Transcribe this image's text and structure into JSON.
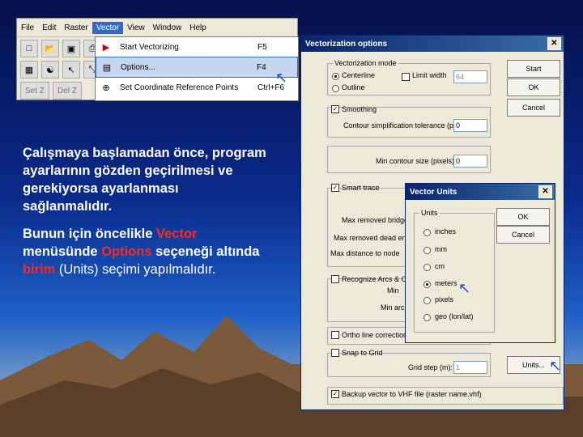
{
  "app": {
    "menu": [
      "File",
      "Edit",
      "Raster",
      "Vector",
      "View",
      "Window",
      "Help"
    ],
    "active_menu": "Vector",
    "toolbar_buttons": [
      "Set Z",
      "Del Z"
    ],
    "dropdown": [
      {
        "label": "Start Vectorizing",
        "key": "F5",
        "icon": "play-icon"
      },
      {
        "label": "Options...",
        "key": "F4",
        "icon": "options-icon"
      },
      {
        "label": "Set Coordinate Reference Points",
        "key": "Ctrl+F6",
        "icon": "crosshair-icon"
      }
    ]
  },
  "text": {
    "p1": "Çalışmaya başlamadan önce, program ayarlarının gözden geçirilmesi ve gerekiyorsa ayarlanması sağlanmalıdır.",
    "p2_a": "Bunun için öncelikle ",
    "p2_vector": "Vector",
    "p2_b": " menüsünde ",
    "p2_options": "Options",
    "p2_c": " seçeneği altında ",
    "p2_birim": "birim",
    "p2_d": " (Units) seçimi yapılmalıdır."
  },
  "dialog": {
    "title": "Vectorization options",
    "mode_group": "Vectorization mode",
    "centerline": "Centerline",
    "outline": "Outline",
    "limit_width": "Limit width",
    "limit_width_value": "64",
    "smoothing": "Smoothing",
    "tolerance_label": "Contour simplification tolerance (pixels):",
    "tolerance_value": "0",
    "min_contour_label": "Min contour size (pixels):",
    "min_contour_value": "0",
    "smart_trace": "Smart trace",
    "max_bridge": "Max removed bridge",
    "max_dead_end": "Max removed dead end",
    "max_dist": "Max distance to node",
    "recognize": "Recognize Arcs & Circles",
    "min_label": "Min",
    "min_arc": "Min arc",
    "ortho": "Ortho line correction",
    "snap_grid": "Snap to Grid",
    "grid_step_label": "Grid step (m):",
    "grid_step_value": "1",
    "backup": "Backup vector to VHF file (raster name.vhf)",
    "btn_start": "Start",
    "btn_ok": "OK",
    "btn_cancel": "Cancel",
    "btn_units": "Units..."
  },
  "units": {
    "title": "Vector Units",
    "group": "Units",
    "options": [
      "inches",
      "mm",
      "cm",
      "meters",
      "pixels",
      "geo (lon/lat)"
    ],
    "selected": "meters",
    "btn_ok": "OK",
    "btn_cancel": "Cancel"
  }
}
